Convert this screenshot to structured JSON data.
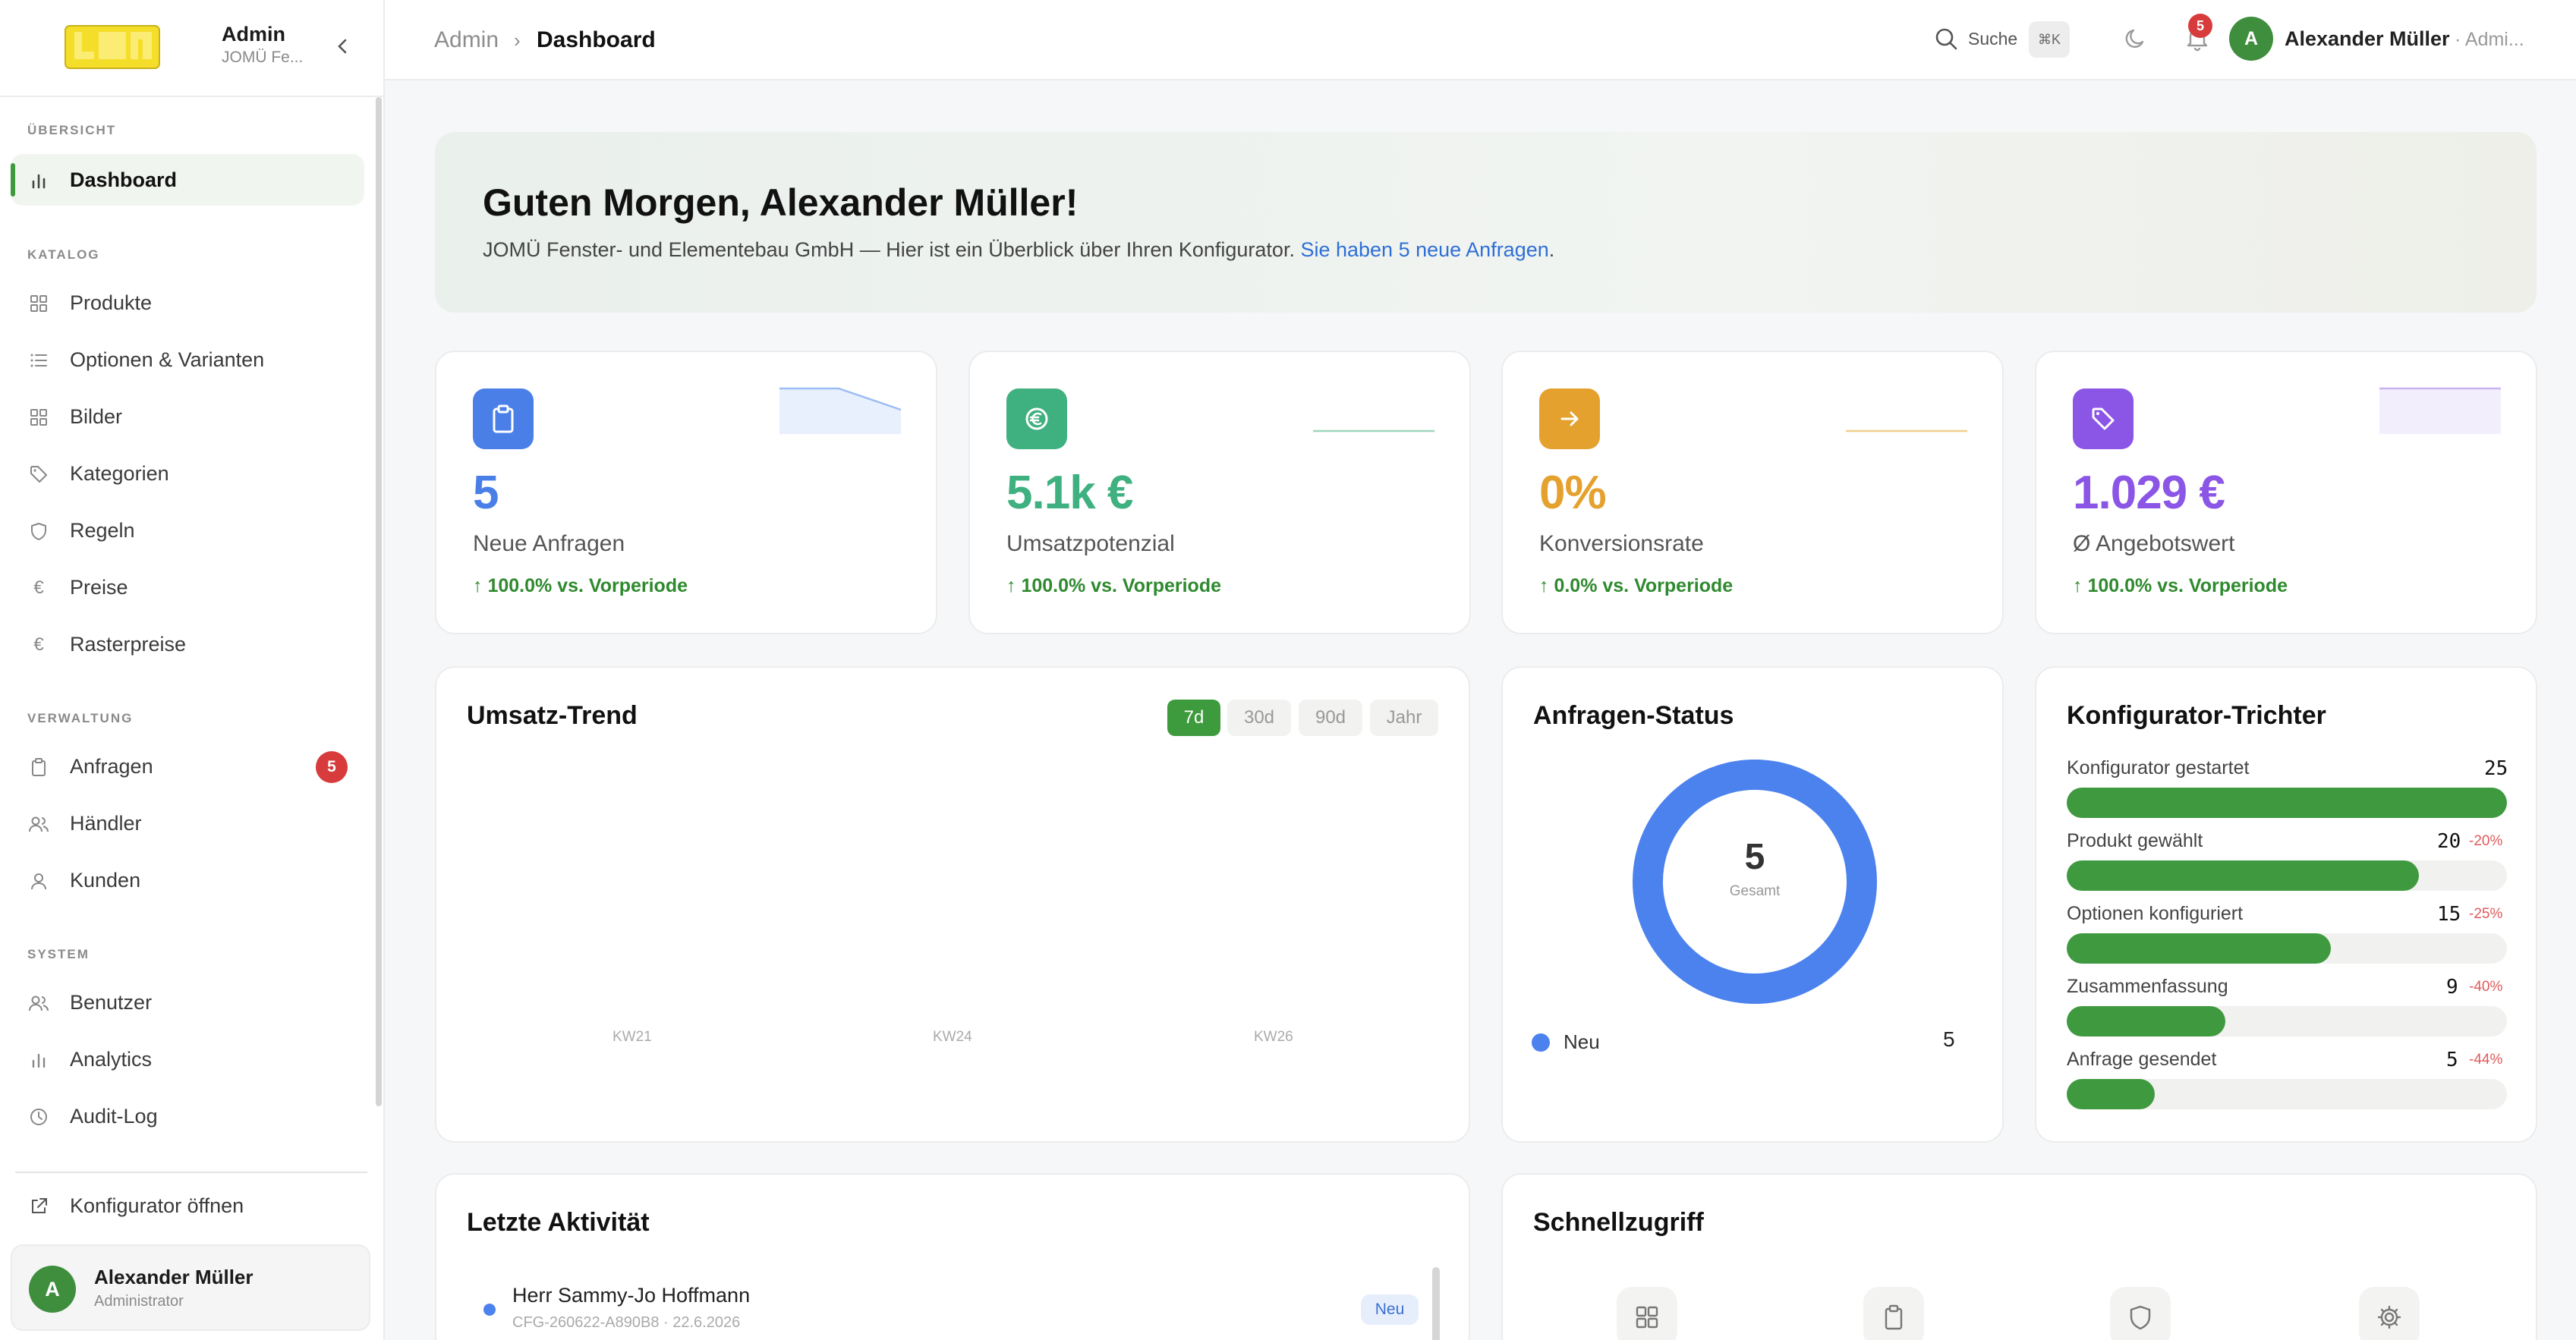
{
  "sidebar": {
    "title": "Admin",
    "subtitle": "JOMÜ Fe...",
    "logo_text": "jomü",
    "sections": [
      "ÜBERSICHT",
      "KATALOG",
      "VERWALTUNG",
      "SYSTEM"
    ],
    "items": [
      {
        "label": "Dashboard",
        "icon": "bar-chart-icon",
        "active": true
      },
      {
        "label": "Produkte",
        "icon": "grid-icon"
      },
      {
        "label": "Optionen & Varianten",
        "icon": "list-icon"
      },
      {
        "label": "Bilder",
        "icon": "grid-icon"
      },
      {
        "label": "Kategorien",
        "icon": "tag-icon"
      },
      {
        "label": "Regeln",
        "icon": "shield-icon"
      },
      {
        "label": "Preise",
        "icon": "euro-icon"
      },
      {
        "label": "Rasterpreise",
        "icon": "euro-icon"
      },
      {
        "label": "Anfragen",
        "icon": "clipboard-icon",
        "badge": "5"
      },
      {
        "label": "Händler",
        "icon": "users-icon"
      },
      {
        "label": "Kunden",
        "icon": "user-icon"
      },
      {
        "label": "Benutzer",
        "icon": "users-icon"
      },
      {
        "label": "Analytics",
        "icon": "bar-chart-icon"
      },
      {
        "label": "Audit-Log",
        "icon": "clock-icon"
      }
    ],
    "external_link": "Konfigurator öffnen",
    "user": {
      "initial": "A",
      "name": "Alexander Müller",
      "role": "Administrator"
    }
  },
  "topbar": {
    "breadcrumb": [
      "Admin",
      "Dashboard"
    ],
    "search_label": "Suche",
    "shortcut": "⌘K",
    "notification_count": "5",
    "user_initial": "A",
    "user_name": "Alexander Müller",
    "user_role": "· Admi..."
  },
  "welcome": {
    "title": "Guten Morgen, Alexander Müller!",
    "text": "JOMÜ Fenster- und Elementebau GmbH — Hier ist ein Überblick über Ihren Konfigurator. ",
    "link": "Sie haben 5 neue Anfragen",
    "suffix": "."
  },
  "kpis": [
    {
      "value": "5",
      "label": "Neue Anfragen",
      "trend": "↑ 100.0% vs. Vorperiode",
      "color": "#4a7fe8",
      "icon": "clipboard-icon"
    },
    {
      "value": "5.1k €",
      "label": "Umsatzpotenzial",
      "trend": "↑ 100.0% vs. Vorperiode",
      "color": "#3fb07f",
      "icon": "euro-icon"
    },
    {
      "value": "0%",
      "label": "Konversionsrate",
      "trend": "↑ 0.0% vs. Vorperiode",
      "color": "#e5a12e",
      "icon": "arrow-right-icon"
    },
    {
      "value": "1.029 €",
      "label": "Ø Angebotswert",
      "trend": "↑ 100.0% vs. Vorperiode",
      "color": "#8b55e6",
      "icon": "tag-icon"
    }
  ],
  "revenue": {
    "title": "Umsatz-Trend",
    "ranges": [
      "7d",
      "30d",
      "90d",
      "Jahr"
    ],
    "selected_range": "7d",
    "x_ticks": [
      "KW21",
      "KW24",
      "KW26"
    ]
  },
  "status": {
    "title": "Anfragen-Status",
    "total": "5",
    "total_label": "Gesamt",
    "legend": [
      {
        "label": "Neu",
        "value": "5",
        "color": "#4c82ee"
      }
    ]
  },
  "funnel": {
    "title": "Konfigurator-Trichter",
    "steps": [
      {
        "label": "Konfigurator gestartet",
        "value": "25",
        "drop": "",
        "fraction": 1.0
      },
      {
        "label": "Produkt gewählt",
        "value": "20",
        "drop": "-20%",
        "fraction": 0.8
      },
      {
        "label": "Optionen konfiguriert",
        "value": "15",
        "drop": "-25%",
        "fraction": 0.6
      },
      {
        "label": "Zusammenfassung",
        "value": "9",
        "drop": "-40%",
        "fraction": 0.36
      },
      {
        "label": "Anfrage gesendet",
        "value": "5",
        "drop": "-44%",
        "fraction": 0.2
      }
    ]
  },
  "activity": {
    "title": "Letzte Aktivität",
    "items": [
      {
        "name": "Herr Sammy-Jo Hoffmann",
        "meta": "CFG-260622-A890B8 · 22.6.2026",
        "badge": "Neu"
      }
    ]
  },
  "quick": {
    "title": "Schnellzugriff",
    "items": [
      "grid-icon",
      "clipboard-icon",
      "shield-icon",
      "gear-icon"
    ]
  }
}
